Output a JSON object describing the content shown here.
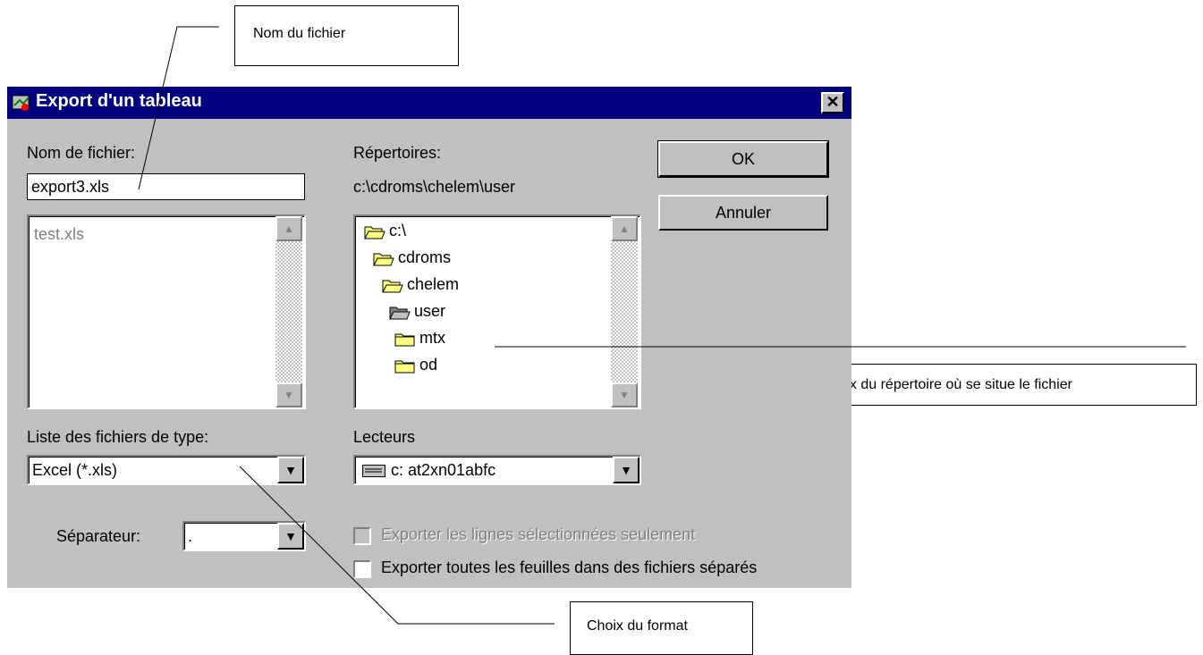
{
  "callouts": {
    "filename": "Nom du fichier",
    "directory": "Choix du répertoire où se situe le fichier",
    "format": "Choix du format"
  },
  "dialog": {
    "title": "Export d'un tableau",
    "close_glyph": "✕",
    "filename_label": "Nom de fichier:",
    "filename_value": "export3.xls",
    "files": [
      "test.xls"
    ],
    "directories_label": "Répertoires:",
    "current_path": "c:\\cdroms\\chelem\\user",
    "folders": [
      {
        "name": "c:\\",
        "icon": "open-folder-icon"
      },
      {
        "name": "cdroms",
        "icon": "open-folder-icon"
      },
      {
        "name": "chelem",
        "icon": "open-folder-icon"
      },
      {
        "name": "user",
        "icon": "open-folder-selected-icon"
      },
      {
        "name": "mtx",
        "icon": "closed-folder-icon"
      },
      {
        "name": "od",
        "icon": "closed-folder-icon"
      }
    ],
    "ok_label": "OK",
    "cancel_label": "Annuler",
    "file_type_label": "Liste des fichiers de type:",
    "file_type_value": "Excel (*.xls)",
    "drives_label": "Lecteurs",
    "drive_value": "c: at2xn01abfc",
    "separator_label": "Séparateur:",
    "separator_value": ".",
    "checkbox_selected_only": "Exporter les lignes sélectionnées seulement",
    "checkbox_all_sheets": "Exporter toutes les feuilles dans des fichiers séparés"
  },
  "colors": {
    "titlebar": "#000080",
    "dialog_bg": "#c0c0c0",
    "folder_yellow": "#ffff80"
  }
}
